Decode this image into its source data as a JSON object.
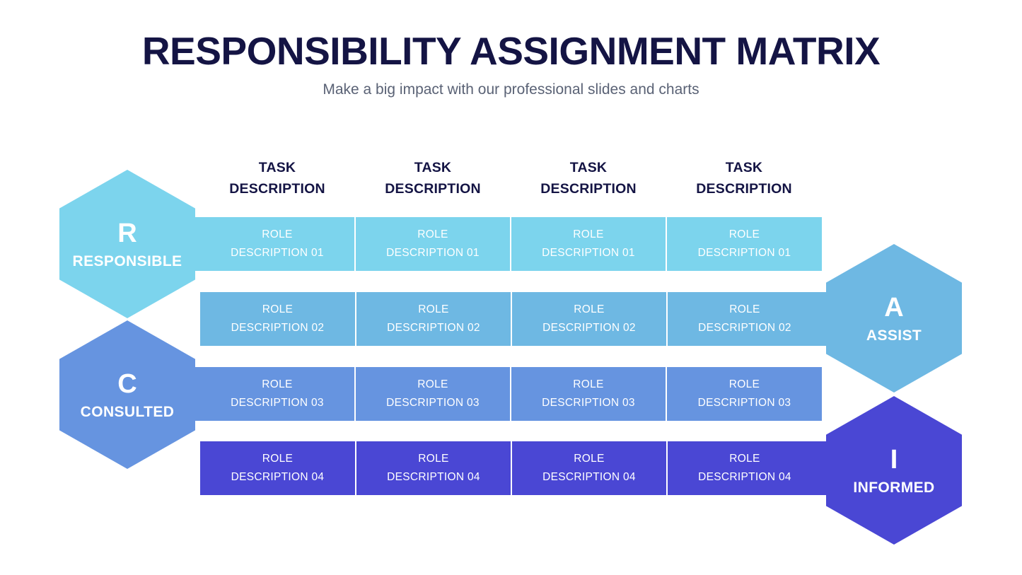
{
  "header": {
    "title": "RESPONSIBILITY ASSIGNMENT MATRIX",
    "subtitle": "Make a big impact with our professional slides and charts",
    "title_color": "#141444",
    "subtitle_color": "#5a6275"
  },
  "columns": [
    {
      "line1": "TASK",
      "line2": "DESCRIPTION"
    },
    {
      "line1": "TASK",
      "line2": "DESCRIPTION"
    },
    {
      "line1": "TASK",
      "line2": "DESCRIPTION"
    },
    {
      "line1": "TASK",
      "line2": "DESCRIPTION"
    }
  ],
  "rows": [
    {
      "id": "row-01",
      "color": "#7cd4ed",
      "cells": [
        {
          "line1": "ROLE",
          "line2": "DESCRIPTION 01"
        },
        {
          "line1": "ROLE",
          "line2": "DESCRIPTION 01"
        },
        {
          "line1": "ROLE",
          "line2": "DESCRIPTION 01"
        },
        {
          "line1": "ROLE",
          "line2": "DESCRIPTION 01"
        }
      ]
    },
    {
      "id": "row-02",
      "color": "#6eb8e3",
      "cells": [
        {
          "line1": "ROLE",
          "line2": "DESCRIPTION 02"
        },
        {
          "line1": "ROLE",
          "line2": "DESCRIPTION 02"
        },
        {
          "line1": "ROLE",
          "line2": "DESCRIPTION 02"
        },
        {
          "line1": "ROLE",
          "line2": "DESCRIPTION 02"
        }
      ]
    },
    {
      "id": "row-03",
      "color": "#6694e0",
      "cells": [
        {
          "line1": "ROLE",
          "line2": "DESCRIPTION 03"
        },
        {
          "line1": "ROLE",
          "line2": "DESCRIPTION 03"
        },
        {
          "line1": "ROLE",
          "line2": "DESCRIPTION 03"
        },
        {
          "line1": "ROLE",
          "line2": "DESCRIPTION 03"
        }
      ]
    },
    {
      "id": "row-04",
      "color": "#4a47d4",
      "cells": [
        {
          "line1": "ROLE",
          "line2": "DESCRIPTION 04"
        },
        {
          "line1": "ROLE",
          "line2": "DESCRIPTION 04"
        },
        {
          "line1": "ROLE",
          "line2": "DESCRIPTION 04"
        },
        {
          "line1": "ROLE",
          "line2": "DESCRIPTION 04"
        }
      ]
    }
  ],
  "hexagons": {
    "responsible": {
      "letter": "R",
      "label": "RESPONSIBLE",
      "color": "#7cd4ed"
    },
    "consulted": {
      "letter": "C",
      "label": "CONSULTED",
      "color": "#6694e0"
    },
    "assist": {
      "letter": "A",
      "label": "ASSIST",
      "color": "#6eb8e3"
    },
    "informed": {
      "letter": "I",
      "label": "INFORMED",
      "color": "#4a47d4"
    }
  }
}
